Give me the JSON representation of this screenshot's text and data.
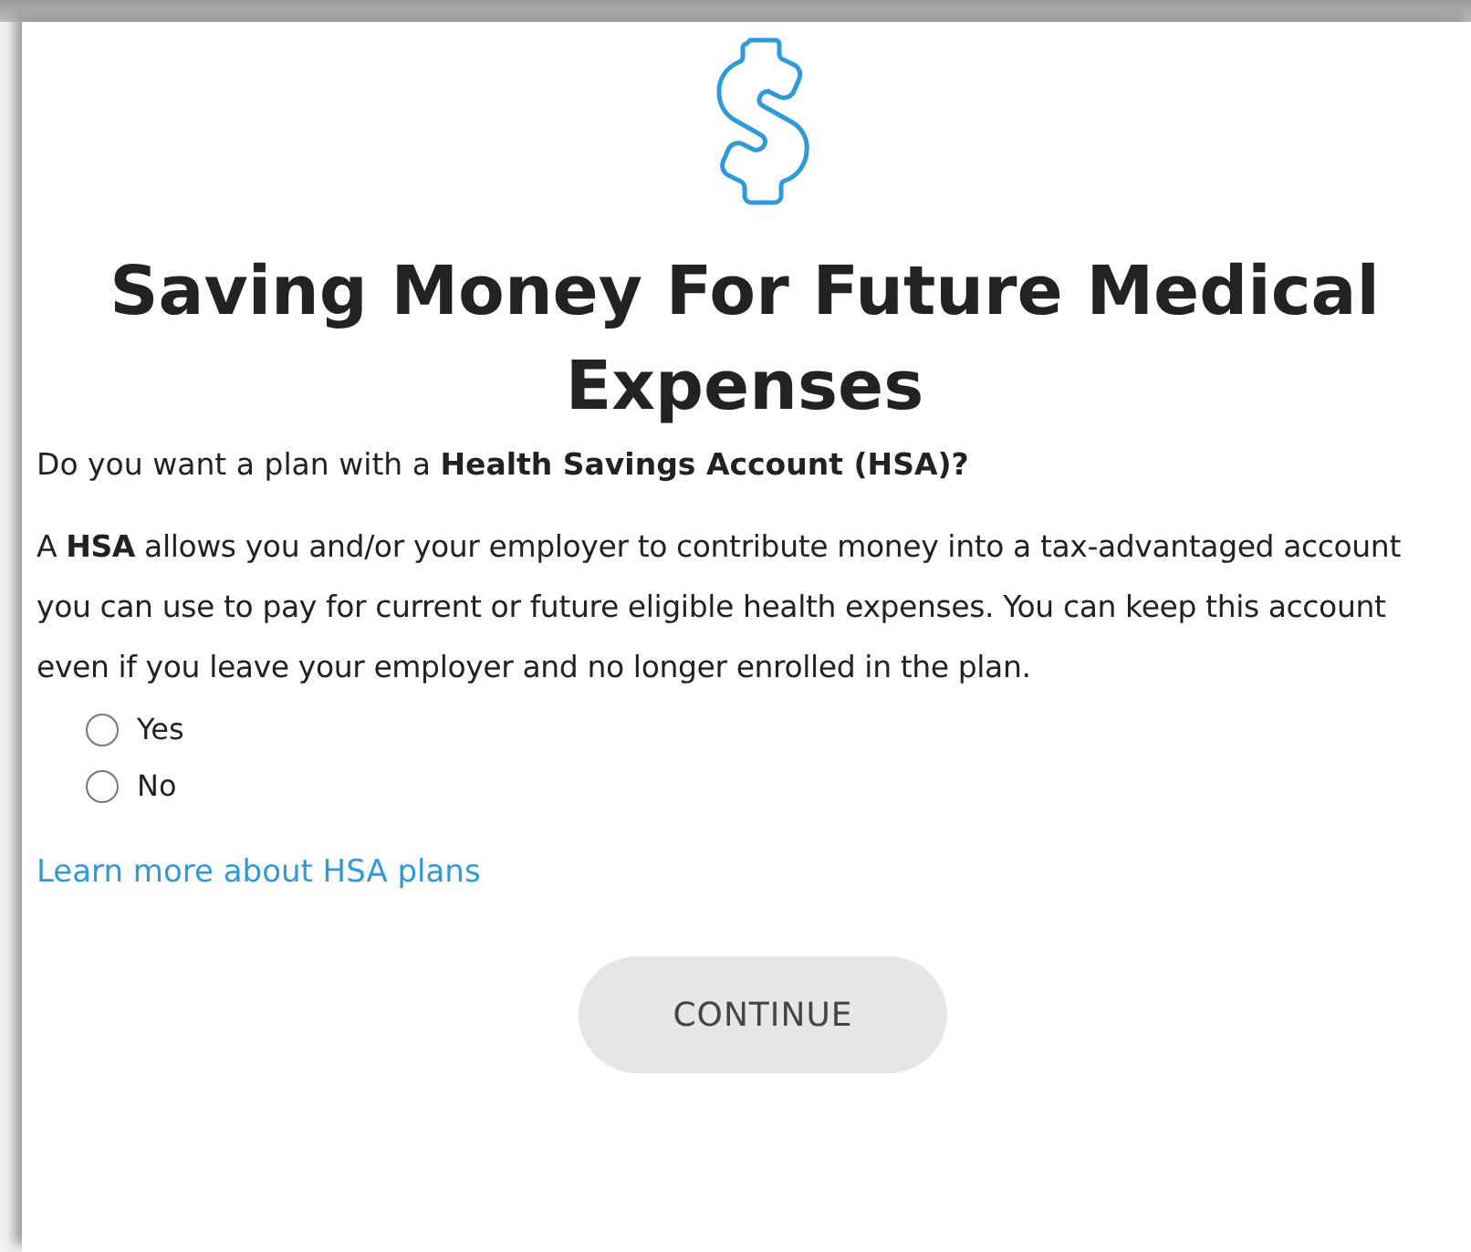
{
  "title": "Saving Money For Future Medical Expenses",
  "question": "Do you want a plan with a **Health Savings Account (HSA)?**",
  "description": "A **HSA** allows you and/or your employer to contribute money into a tax-advantaged account you can use to pay for current or future eligible health expenses. You can keep this account even if you leave your employer and no longer enrolled in the plan.",
  "options": [
    {
      "label": "Yes",
      "selected": false
    },
    {
      "label": "No",
      "selected": false
    }
  ],
  "link": "Learn more about HSA plans",
  "continue_button": {
    "label": "CONTINUE",
    "disabled": true
  }
}
